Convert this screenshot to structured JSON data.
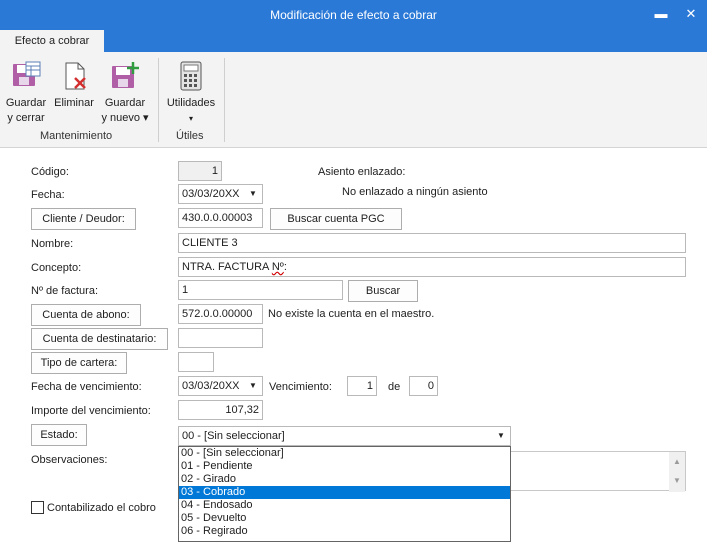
{
  "window": {
    "title": "Modificación de efecto a cobrar",
    "minimize_icon": "▬",
    "close_icon": "✕"
  },
  "ribbon": {
    "tab": "Efecto a cobrar",
    "buttons": {
      "save_close": [
        "Guardar",
        "y cerrar"
      ],
      "delete": [
        "Eliminar"
      ],
      "save_new": [
        "Guardar",
        "y nuevo ▾"
      ],
      "utilities": [
        "Utilidades",
        "▾"
      ]
    },
    "groups": {
      "maintenance": "Mantenimiento",
      "useful": "Útiles"
    }
  },
  "form": {
    "codigo": {
      "label": "Código:",
      "value": "1"
    },
    "asiento": {
      "label": "Asiento enlazado:",
      "value": "No enlazado a ningún asiento"
    },
    "fecha": {
      "label": "Fecha:",
      "value": "03/03/20XX"
    },
    "cliente": {
      "label": "Cliente / Deudor:",
      "value": "430.0.0.00003",
      "search": "Buscar cuenta PGC"
    },
    "nombre": {
      "label": "Nombre:",
      "value": "CLIENTE 3"
    },
    "concepto": {
      "label": "Concepto:",
      "value_a": "NTRA. FACTURA ",
      "value_b": "Nº",
      "value_c": ":"
    },
    "factura": {
      "label": "Nº de factura:",
      "value": "1",
      "search": "Buscar"
    },
    "abono": {
      "label": "Cuenta de abono:",
      "value": "572.0.0.00000",
      "message": "No existe la cuenta en el maestro."
    },
    "destinatario": {
      "label": "Cuenta de destinatario:",
      "value": ""
    },
    "cartera": {
      "label": "Tipo de cartera:",
      "value": ""
    },
    "vencimiento": {
      "label": "Fecha de vencimiento:",
      "value": "03/03/20XX",
      "count_label": "Vencimiento:",
      "current": "1",
      "of_label": "de",
      "total": "0"
    },
    "importe": {
      "label": "Importe del vencimiento:",
      "value": "107,32"
    },
    "estado": {
      "label": "Estado:",
      "value": "00 - [Sin seleccionar]"
    },
    "observaciones": {
      "label": "Observaciones:"
    },
    "contabilizado": {
      "label": "Contabilizado el cobro",
      "checked": false
    }
  },
  "estado_options": [
    {
      "label": "00 - [Sin seleccionar]",
      "selected": false
    },
    {
      "label": "01 - Pendiente",
      "selected": false
    },
    {
      "label": "02 - Girado",
      "selected": false
    },
    {
      "label": "03 - Cobrado",
      "selected": true
    },
    {
      "label": "04 - Endosado",
      "selected": false
    },
    {
      "label": "05 - Devuelto",
      "selected": false
    },
    {
      "label": "06 - Regirado",
      "selected": false
    }
  ],
  "colors": {
    "title_bar": "#2b79d7",
    "selection": "#0078d7",
    "ribbon": "#f3f3f3"
  }
}
